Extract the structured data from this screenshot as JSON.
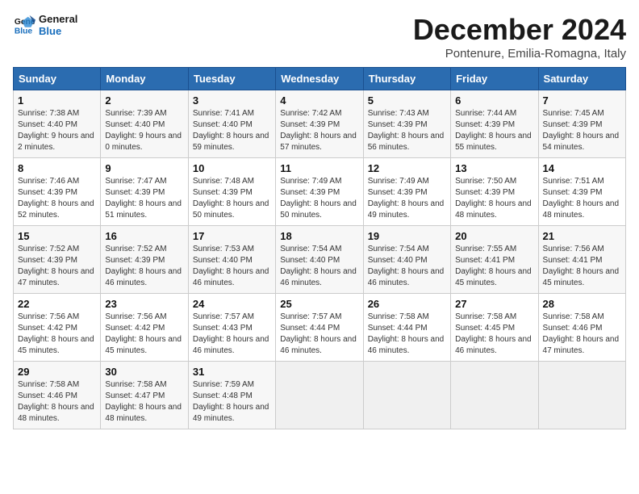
{
  "logo": {
    "line1": "General",
    "line2": "Blue"
  },
  "title": "December 2024",
  "location": "Pontenure, Emilia-Romagna, Italy",
  "days_of_week": [
    "Sunday",
    "Monday",
    "Tuesday",
    "Wednesday",
    "Thursday",
    "Friday",
    "Saturday"
  ],
  "weeks": [
    [
      {
        "day": "1",
        "sunrise": "Sunrise: 7:38 AM",
        "sunset": "Sunset: 4:40 PM",
        "daylight": "Daylight: 9 hours and 2 minutes."
      },
      {
        "day": "2",
        "sunrise": "Sunrise: 7:39 AM",
        "sunset": "Sunset: 4:40 PM",
        "daylight": "Daylight: 9 hours and 0 minutes."
      },
      {
        "day": "3",
        "sunrise": "Sunrise: 7:41 AM",
        "sunset": "Sunset: 4:40 PM",
        "daylight": "Daylight: 8 hours and 59 minutes."
      },
      {
        "day": "4",
        "sunrise": "Sunrise: 7:42 AM",
        "sunset": "Sunset: 4:39 PM",
        "daylight": "Daylight: 8 hours and 57 minutes."
      },
      {
        "day": "5",
        "sunrise": "Sunrise: 7:43 AM",
        "sunset": "Sunset: 4:39 PM",
        "daylight": "Daylight: 8 hours and 56 minutes."
      },
      {
        "day": "6",
        "sunrise": "Sunrise: 7:44 AM",
        "sunset": "Sunset: 4:39 PM",
        "daylight": "Daylight: 8 hours and 55 minutes."
      },
      {
        "day": "7",
        "sunrise": "Sunrise: 7:45 AM",
        "sunset": "Sunset: 4:39 PM",
        "daylight": "Daylight: 8 hours and 54 minutes."
      }
    ],
    [
      {
        "day": "8",
        "sunrise": "Sunrise: 7:46 AM",
        "sunset": "Sunset: 4:39 PM",
        "daylight": "Daylight: 8 hours and 52 minutes."
      },
      {
        "day": "9",
        "sunrise": "Sunrise: 7:47 AM",
        "sunset": "Sunset: 4:39 PM",
        "daylight": "Daylight: 8 hours and 51 minutes."
      },
      {
        "day": "10",
        "sunrise": "Sunrise: 7:48 AM",
        "sunset": "Sunset: 4:39 PM",
        "daylight": "Daylight: 8 hours and 50 minutes."
      },
      {
        "day": "11",
        "sunrise": "Sunrise: 7:49 AM",
        "sunset": "Sunset: 4:39 PM",
        "daylight": "Daylight: 8 hours and 50 minutes."
      },
      {
        "day": "12",
        "sunrise": "Sunrise: 7:49 AM",
        "sunset": "Sunset: 4:39 PM",
        "daylight": "Daylight: 8 hours and 49 minutes."
      },
      {
        "day": "13",
        "sunrise": "Sunrise: 7:50 AM",
        "sunset": "Sunset: 4:39 PM",
        "daylight": "Daylight: 8 hours and 48 minutes."
      },
      {
        "day": "14",
        "sunrise": "Sunrise: 7:51 AM",
        "sunset": "Sunset: 4:39 PM",
        "daylight": "Daylight: 8 hours and 48 minutes."
      }
    ],
    [
      {
        "day": "15",
        "sunrise": "Sunrise: 7:52 AM",
        "sunset": "Sunset: 4:39 PM",
        "daylight": "Daylight: 8 hours and 47 minutes."
      },
      {
        "day": "16",
        "sunrise": "Sunrise: 7:52 AM",
        "sunset": "Sunset: 4:39 PM",
        "daylight": "Daylight: 8 hours and 46 minutes."
      },
      {
        "day": "17",
        "sunrise": "Sunrise: 7:53 AM",
        "sunset": "Sunset: 4:40 PM",
        "daylight": "Daylight: 8 hours and 46 minutes."
      },
      {
        "day": "18",
        "sunrise": "Sunrise: 7:54 AM",
        "sunset": "Sunset: 4:40 PM",
        "daylight": "Daylight: 8 hours and 46 minutes."
      },
      {
        "day": "19",
        "sunrise": "Sunrise: 7:54 AM",
        "sunset": "Sunset: 4:40 PM",
        "daylight": "Daylight: 8 hours and 46 minutes."
      },
      {
        "day": "20",
        "sunrise": "Sunrise: 7:55 AM",
        "sunset": "Sunset: 4:41 PM",
        "daylight": "Daylight: 8 hours and 45 minutes."
      },
      {
        "day": "21",
        "sunrise": "Sunrise: 7:56 AM",
        "sunset": "Sunset: 4:41 PM",
        "daylight": "Daylight: 8 hours and 45 minutes."
      }
    ],
    [
      {
        "day": "22",
        "sunrise": "Sunrise: 7:56 AM",
        "sunset": "Sunset: 4:42 PM",
        "daylight": "Daylight: 8 hours and 45 minutes."
      },
      {
        "day": "23",
        "sunrise": "Sunrise: 7:56 AM",
        "sunset": "Sunset: 4:42 PM",
        "daylight": "Daylight: 8 hours and 45 minutes."
      },
      {
        "day": "24",
        "sunrise": "Sunrise: 7:57 AM",
        "sunset": "Sunset: 4:43 PM",
        "daylight": "Daylight: 8 hours and 46 minutes."
      },
      {
        "day": "25",
        "sunrise": "Sunrise: 7:57 AM",
        "sunset": "Sunset: 4:44 PM",
        "daylight": "Daylight: 8 hours and 46 minutes."
      },
      {
        "day": "26",
        "sunrise": "Sunrise: 7:58 AM",
        "sunset": "Sunset: 4:44 PM",
        "daylight": "Daylight: 8 hours and 46 minutes."
      },
      {
        "day": "27",
        "sunrise": "Sunrise: 7:58 AM",
        "sunset": "Sunset: 4:45 PM",
        "daylight": "Daylight: 8 hours and 46 minutes."
      },
      {
        "day": "28",
        "sunrise": "Sunrise: 7:58 AM",
        "sunset": "Sunset: 4:46 PM",
        "daylight": "Daylight: 8 hours and 47 minutes."
      }
    ],
    [
      {
        "day": "29",
        "sunrise": "Sunrise: 7:58 AM",
        "sunset": "Sunset: 4:46 PM",
        "daylight": "Daylight: 8 hours and 48 minutes."
      },
      {
        "day": "30",
        "sunrise": "Sunrise: 7:58 AM",
        "sunset": "Sunset: 4:47 PM",
        "daylight": "Daylight: 8 hours and 48 minutes."
      },
      {
        "day": "31",
        "sunrise": "Sunrise: 7:59 AM",
        "sunset": "Sunset: 4:48 PM",
        "daylight": "Daylight: 8 hours and 49 minutes."
      },
      null,
      null,
      null,
      null
    ]
  ]
}
